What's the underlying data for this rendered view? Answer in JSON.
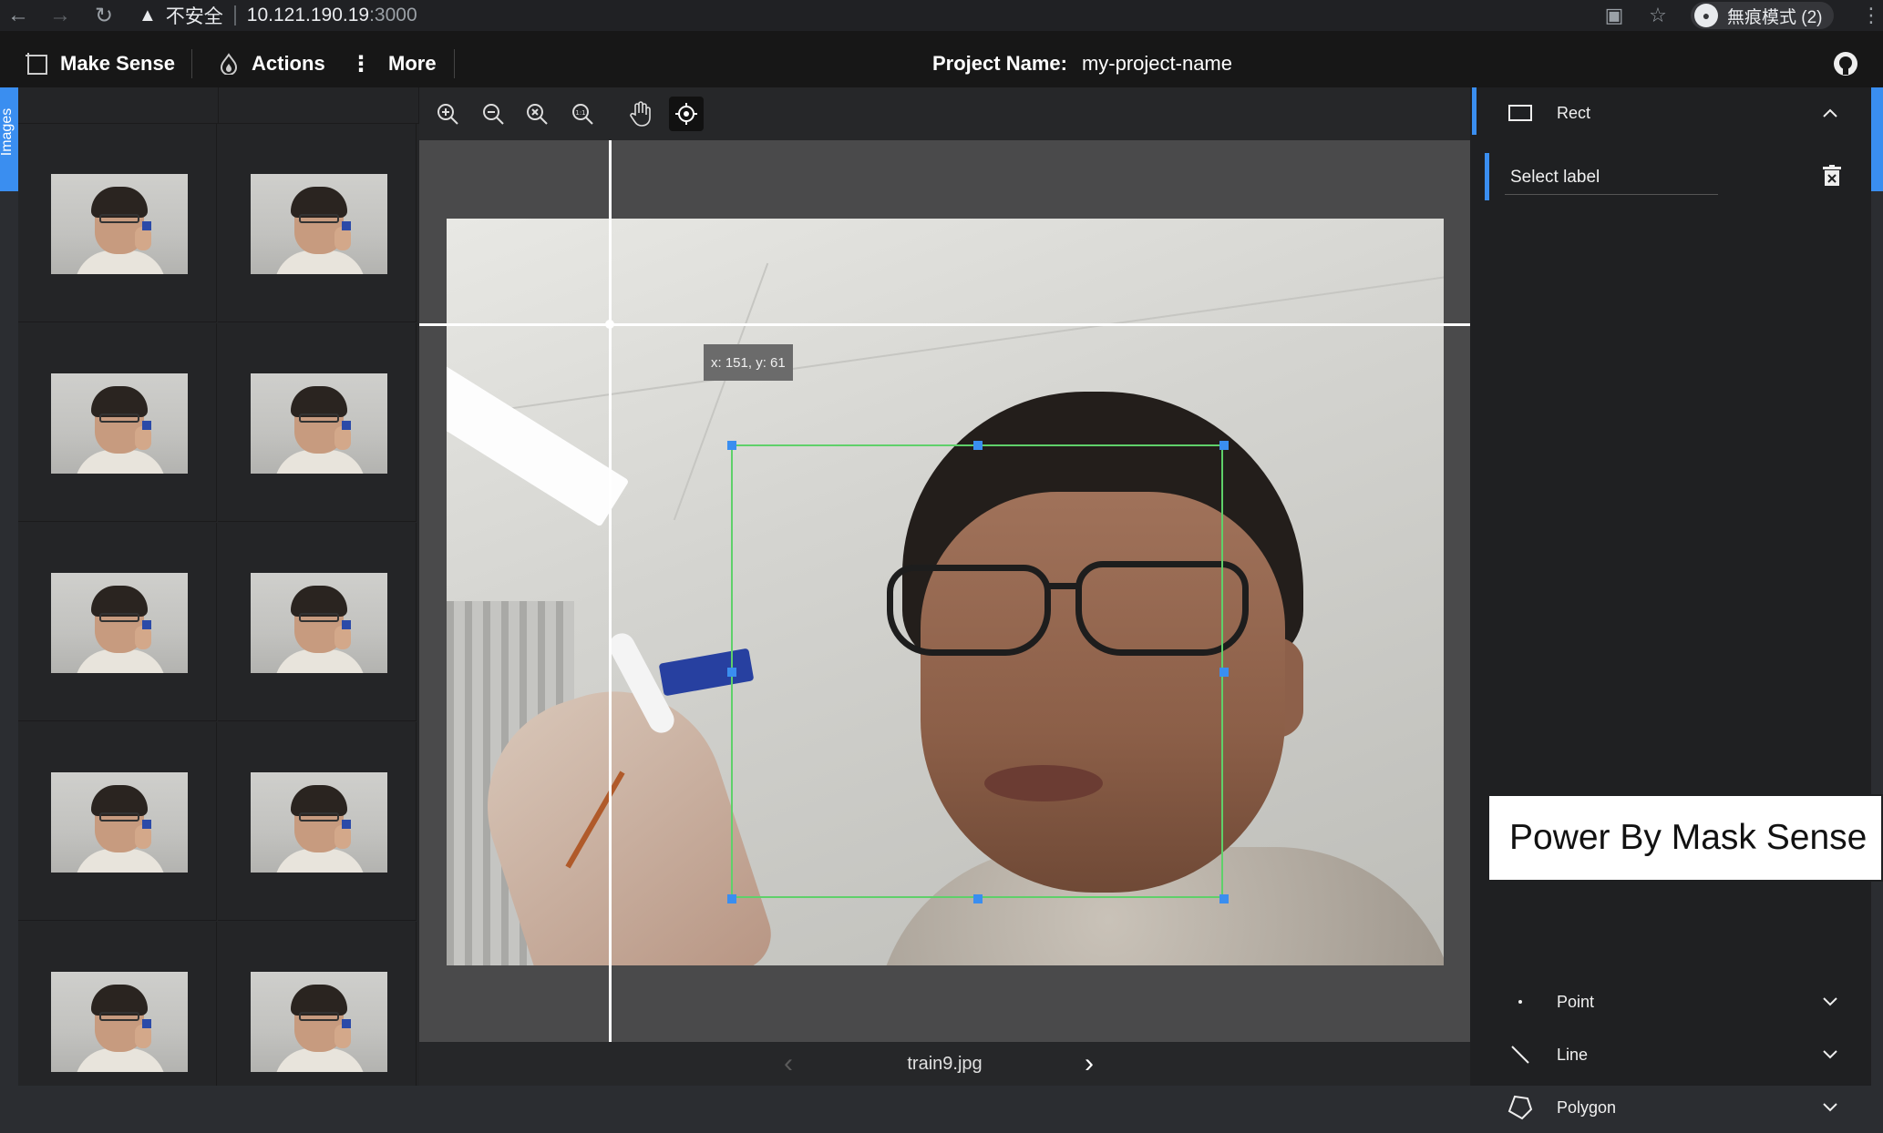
{
  "browser": {
    "insecure_label": "不安全",
    "host": "10.121.190.19",
    "port": ":3000",
    "incognito_label": "無痕模式 (2)"
  },
  "navbar": {
    "app_name": "Make Sense",
    "actions_label": "Actions",
    "more_label": "More",
    "project_label": "Project Name:",
    "project_value": "my-project-name"
  },
  "image_list": {
    "tab_label": "Images",
    "thumb_count": 10
  },
  "editor": {
    "coord_tip": "x: 151, y: 61",
    "file_name": "train9.jpg",
    "tools": [
      "zoom-in-icon",
      "zoom-out-icon",
      "zoom-fit-icon",
      "zoom-reset-icon",
      "hand-icon",
      "crosshair-icon"
    ]
  },
  "label_panel": {
    "rect_label": "Rect",
    "select_label": "Select label",
    "point_label": "Point",
    "line_label": "Line",
    "polygon_label": "Polygon"
  },
  "overlay": {
    "power_banner": "Power By Mask Sense"
  },
  "colors": {
    "accent": "#3a8ef0",
    "bbox": "#5fd06a",
    "navbar": "#171717"
  }
}
